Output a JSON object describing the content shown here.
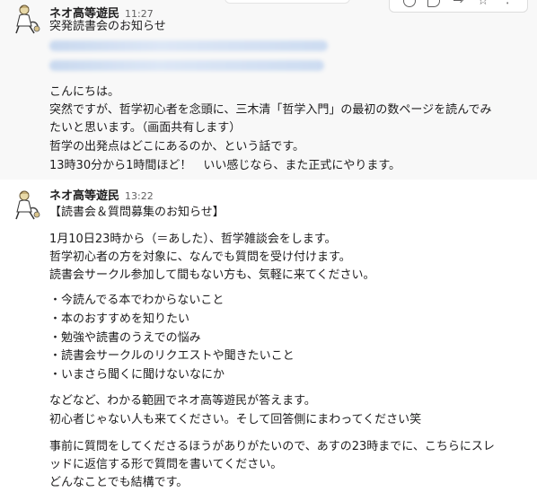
{
  "messages": [
    {
      "author": "ネオ高等遊民",
      "time": "11:27",
      "lines": [
        "突発読書会のお知らせ",
        "",
        "",
        "",
        "こんにちは。",
        "突然ですが、哲学初心者を念頭に、三木清「哲学入門」の最初の数ページを読んでみ",
        "たいと思います。（画面共有します）",
        "哲学の出発点はどこにあるのか、という話です。",
        "13時30分から1時間ほど！　いい感じなら、また正式にやります。"
      ]
    },
    {
      "author": "ネオ高等遊民",
      "time": "13:22",
      "title": "【読書会＆質問募集のお知らせ】",
      "para1": [
        "1月10日23時から（＝あした）、哲学雑談会をします。",
        "哲学初心者の方を対象に、なんでも質問を受け付けます。",
        "読書会サークル参加して間もない方も、気軽に来てください。"
      ],
      "bullets": [
        "・今読んでる本でわからないこと",
        "・本のおすすめを知りたい",
        "・勉強や読書のうえでの悩み",
        "・読書会サークルのリクエストや聞きたいこと",
        "・いまさら聞くに聞けないなにか"
      ],
      "para2": [
        "などなど、わかる範囲でネオ高等遊民が答えます。",
        "初心者じゃない人も来てください。そして回答側にまわってください笑"
      ],
      "para3": [
        "事前に質問をしてくださるほうがありがたいので、あすの23時までに、こちらにスレ",
        "ッドに返信する形で質問を書いてください。",
        "どんなことでも結構です。"
      ]
    }
  ],
  "toolbar": {
    "icons": [
      "emoji-reaction-icon",
      "reply-thread-icon",
      "share-arrow-icon",
      "bookmark-star-icon",
      "more-actions-icon"
    ]
  }
}
